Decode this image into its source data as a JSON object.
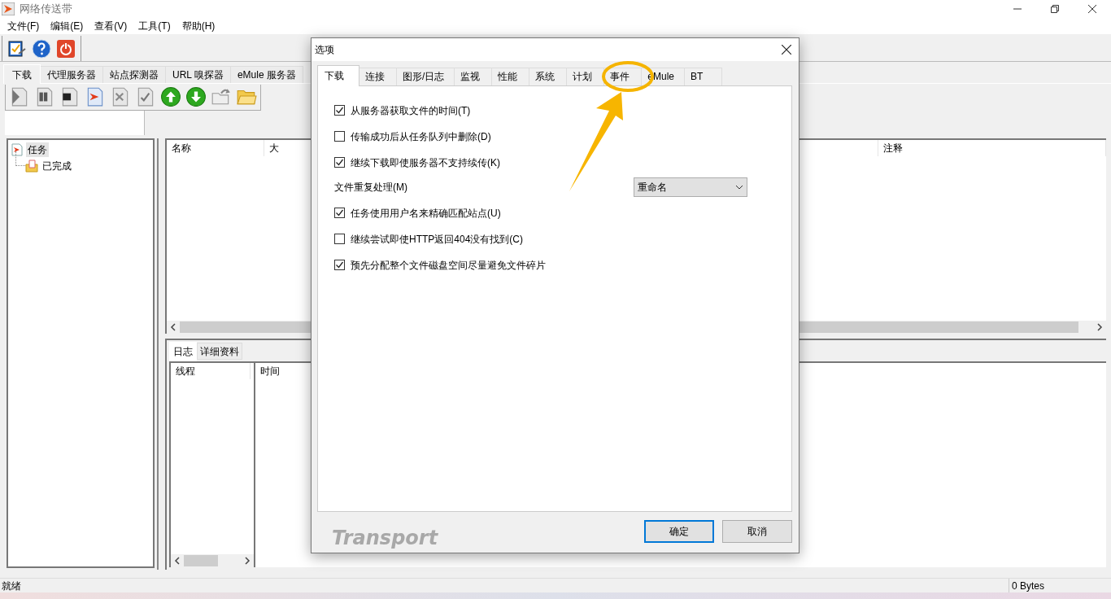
{
  "window": {
    "title": "网络传送带"
  },
  "menu": [
    "文件(F)",
    "编辑(E)",
    "查看(V)",
    "工具(T)",
    "帮助(H)"
  ],
  "main_tabs": [
    {
      "label": "下载",
      "selected": true
    },
    {
      "label": "代理服务器",
      "selected": false
    },
    {
      "label": "站点探测器",
      "selected": false
    },
    {
      "label": "URL 嗅探器",
      "selected": false
    },
    {
      "label": "eMule 服务器",
      "selected": false
    }
  ],
  "tree": [
    {
      "label": "任务",
      "selected": true,
      "children": [
        {
          "label": "已完成",
          "selected": false
        }
      ]
    }
  ],
  "task_table": {
    "columns": [
      "名称",
      "大",
      "注释"
    ]
  },
  "log_tabs": [
    {
      "label": "日志",
      "selected": true
    },
    {
      "label": "详细资料",
      "selected": false
    }
  ],
  "log_table": {
    "columns": [
      "线程",
      "时间"
    ]
  },
  "status_bar": {
    "message": "就绪",
    "bytes": "0 Bytes"
  },
  "dialog": {
    "title": "选项",
    "tabs": [
      {
        "label": "下载",
        "selected": true
      },
      {
        "label": "连接",
        "selected": false
      },
      {
        "label": "图形/日志",
        "selected": false
      },
      {
        "label": "监视",
        "selected": false
      },
      {
        "label": "性能",
        "selected": false
      },
      {
        "label": "系统",
        "selected": false
      },
      {
        "label": "计划",
        "selected": false
      },
      {
        "label": "事件",
        "selected": false
      },
      {
        "label": "eMule",
        "selected": false
      },
      {
        "label": "BT",
        "selected": false
      }
    ],
    "options": [
      {
        "kind": "checkbox",
        "label": "从服务器获取文件的时间(T)",
        "checked": true
      },
      {
        "kind": "checkbox",
        "label": "传输成功后从任务队列中删除(D)",
        "checked": false
      },
      {
        "kind": "checkbox",
        "label": "继续下载即使服务器不支持续传(K)",
        "checked": true
      },
      {
        "kind": "dropdown",
        "label": "文件重复处理(M)",
        "value": "重命名"
      },
      {
        "kind": "checkbox",
        "label": "任务使用用户名来精确匹配站点(U)",
        "checked": true
      },
      {
        "kind": "checkbox",
        "label": "继续尝试即使HTTP返回404没有找到(C)",
        "checked": false
      },
      {
        "kind": "checkbox",
        "label": "预先分配整个文件磁盘空间尽量避免文件碎片",
        "checked": true
      }
    ],
    "logo": "Transport",
    "buttons": [
      {
        "label": "确定",
        "default": true
      },
      {
        "label": "取消",
        "default": false
      }
    ]
  }
}
